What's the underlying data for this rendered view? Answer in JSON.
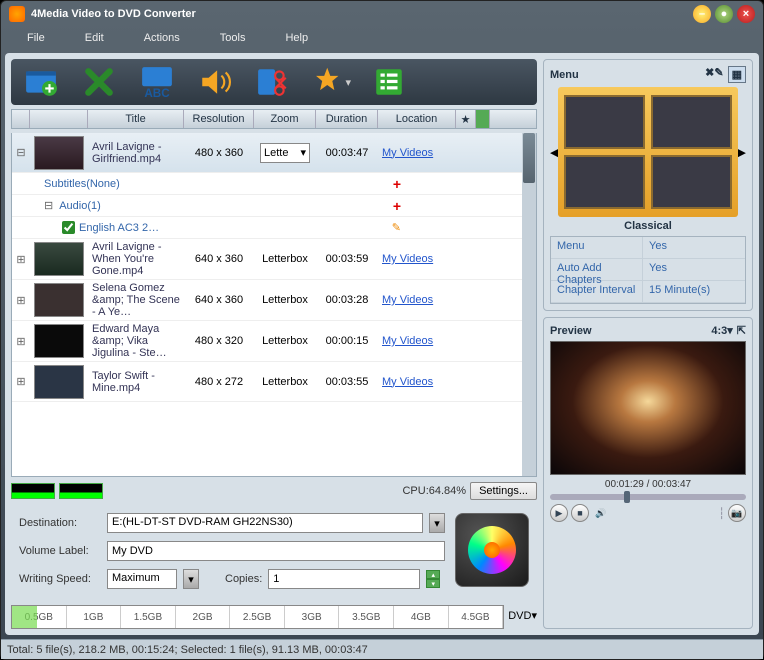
{
  "app": {
    "title": "4Media Video to DVD Converter"
  },
  "menubar": [
    "File",
    "Edit",
    "Actions",
    "Tools",
    "Help"
  ],
  "columns": {
    "title": "Title",
    "resolution": "Resolution",
    "zoom": "Zoom",
    "duration": "Duration",
    "location": "Location",
    "star": "★"
  },
  "rows": [
    {
      "title": "Avril Lavigne - Girlfriend.mp4",
      "res": "480 x 360",
      "zoom": "Lette",
      "dur": "00:03:47",
      "loc": "My Videos",
      "selected": true,
      "expanded": true
    },
    {
      "title": "Avril Lavigne - When You're Gone.mp4",
      "res": "640 x 360",
      "zoom": "Letterbox",
      "dur": "00:03:59",
      "loc": "My Videos"
    },
    {
      "title": "Selena Gomez &amp; The Scene - A Ye…",
      "res": "640 x 360",
      "zoom": "Letterbox",
      "dur": "00:03:28",
      "loc": "My Videos"
    },
    {
      "title": "Edward Maya &amp; Vika Jigulina - Ste…",
      "res": "480 x 320",
      "zoom": "Letterbox",
      "dur": "00:00:15",
      "loc": "My Videos"
    },
    {
      "title": "Taylor Swift - Mine.mp4",
      "res": "480 x 272",
      "zoom": "Letterbox",
      "dur": "00:03:55",
      "loc": "My Videos"
    }
  ],
  "subrows": {
    "subtitles": "Subtitles(None)",
    "audio": "Audio(1)",
    "track": "English AC3 2…"
  },
  "cpu": {
    "label": "CPU:64.84%",
    "settings": "Settings..."
  },
  "dest": {
    "label_dest": "Destination:",
    "dest_val": "E:(HL-DT-ST DVD-RAM GH22NS30)",
    "label_vol": "Volume Label:",
    "vol_val": "My DVD",
    "label_speed": "Writing Speed:",
    "speed_val": "Maximum",
    "label_copies": "Copies:",
    "copies_val": "1"
  },
  "sizeticks": [
    "0.5GB",
    "1GB",
    "1.5GB",
    "2GB",
    "2.5GB",
    "3GB",
    "3.5GB",
    "4GB",
    "4.5GB"
  ],
  "disc_type": "DVD",
  "status": "Total: 5 file(s), 218.2 MB,  00:15:24; Selected: 1 file(s), 91.13 MB, 00:03:47",
  "menu_panel": {
    "title": "Menu",
    "theme": "Classical"
  },
  "props": [
    {
      "k": "Menu",
      "v": "Yes"
    },
    {
      "k": "Auto Add Chapters",
      "v": "Yes"
    },
    {
      "k": "Chapter Interval",
      "v": "15 Minute(s)"
    }
  ],
  "preview": {
    "title": "Preview",
    "aspect": "4:3",
    "time": "00:01:29 / 00:03:47"
  }
}
